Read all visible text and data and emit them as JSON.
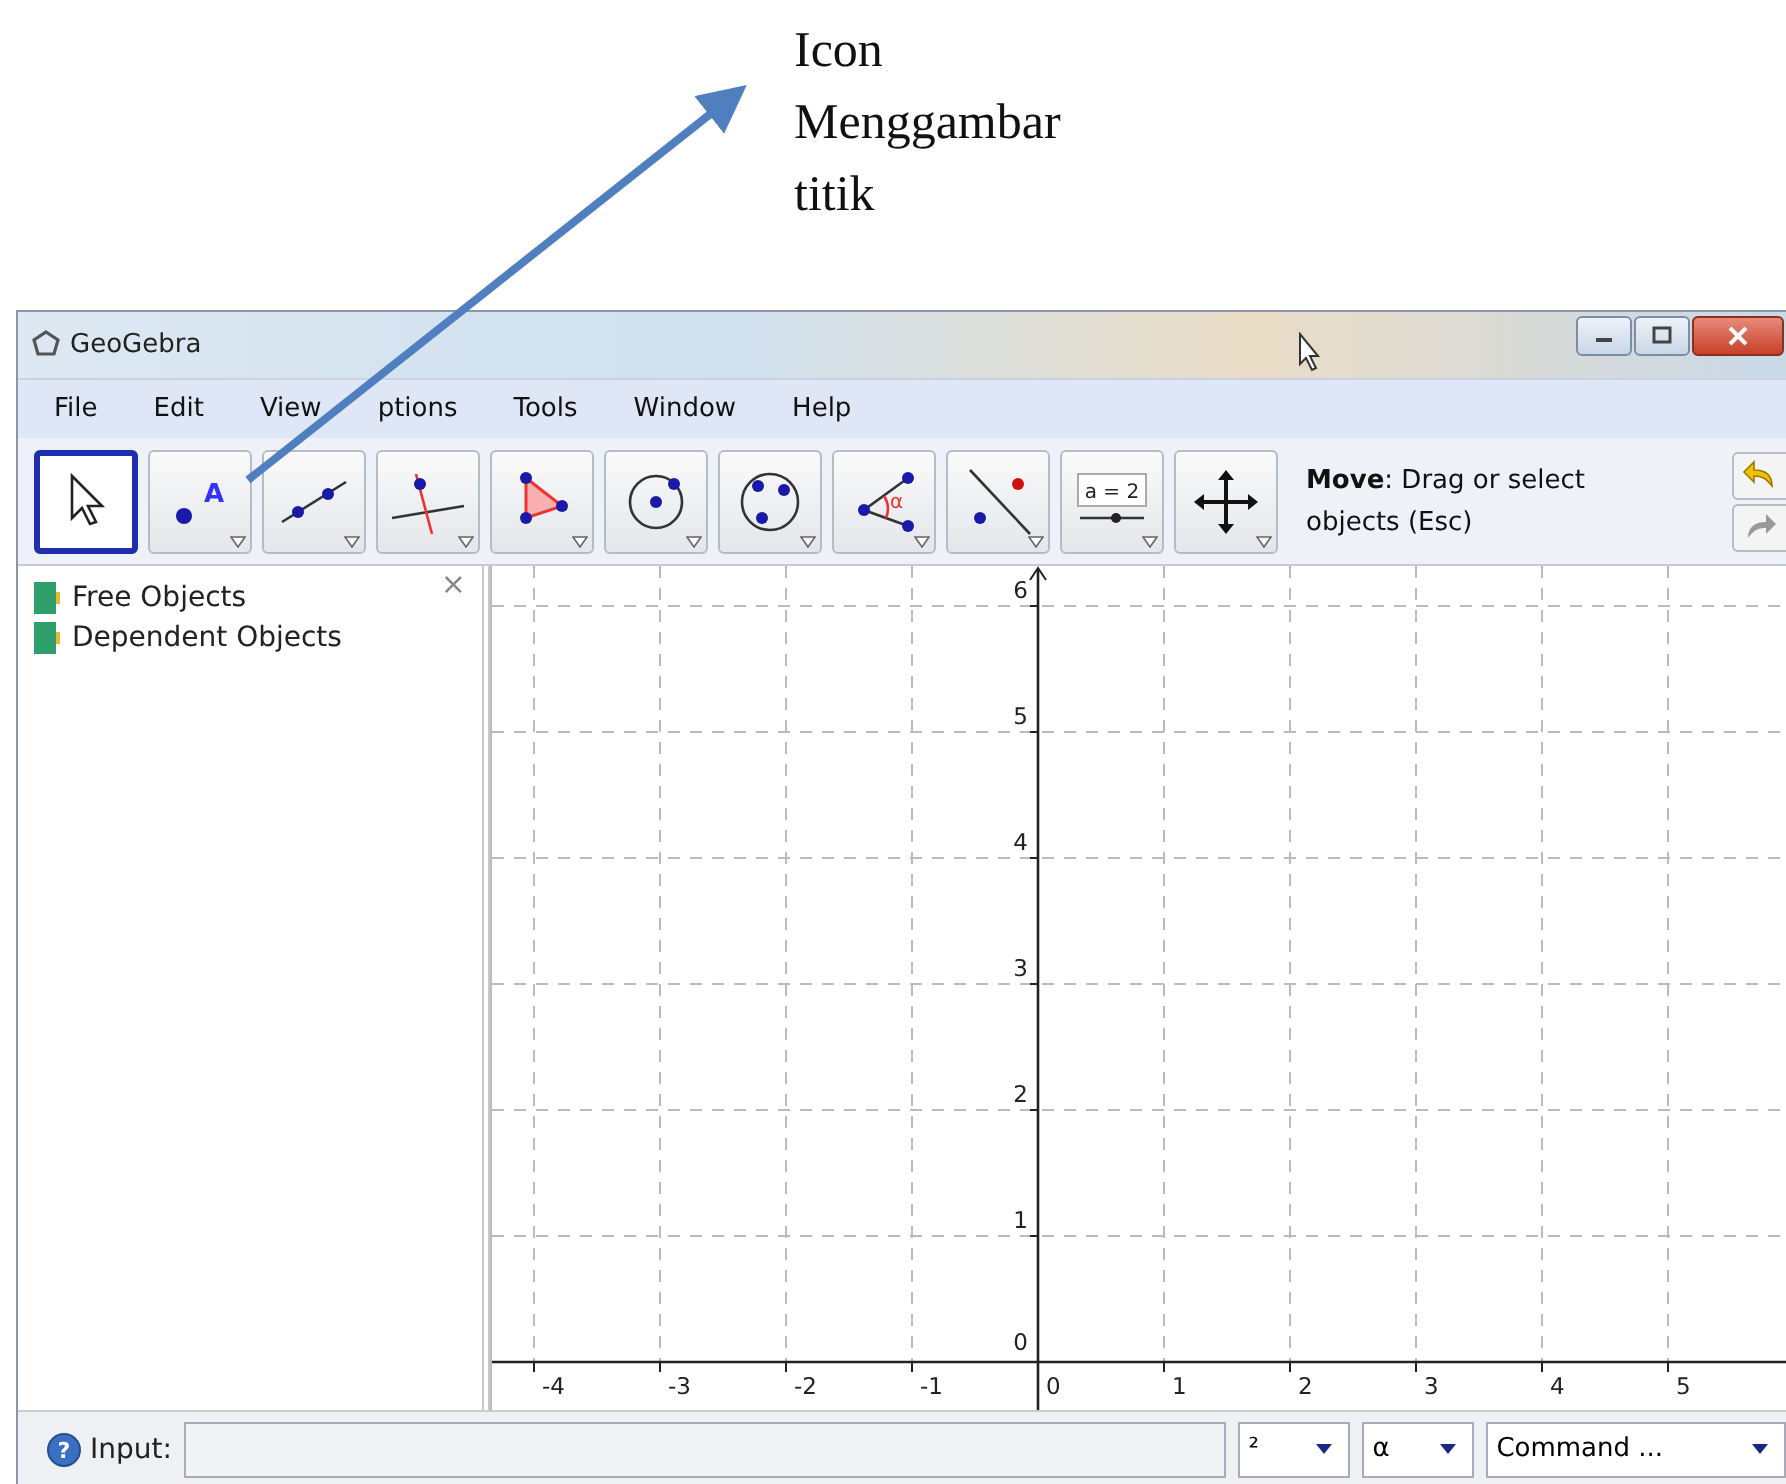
{
  "annotation": {
    "text": "Icon Menggambar titik"
  },
  "window": {
    "title": "GeoGebra"
  },
  "menu": [
    "File",
    "Edit",
    "View",
    "ptions",
    "Tools",
    "Window",
    "Help"
  ],
  "toolbar": {
    "tools": [
      {
        "kind": "move",
        "selected": true
      },
      {
        "kind": "point",
        "selected": false,
        "glyph": "A"
      },
      {
        "kind": "line",
        "selected": false
      },
      {
        "kind": "perpendicular",
        "selected": false
      },
      {
        "kind": "polygon",
        "selected": false
      },
      {
        "kind": "circle",
        "selected": false
      },
      {
        "kind": "conic",
        "selected": false
      },
      {
        "kind": "angle",
        "selected": false,
        "glyph": "α"
      },
      {
        "kind": "reflect",
        "selected": false
      },
      {
        "kind": "slider",
        "selected": false,
        "glyph": "a = 2"
      },
      {
        "kind": "move_view",
        "selected": false
      }
    ],
    "help": "**Move**: Drag or select objects (Esc)"
  },
  "algebra": {
    "items": [
      "Free Objects",
      "Dependent Objects"
    ],
    "close": "×"
  },
  "graphics": {
    "x_labels": [
      "-4",
      "-3",
      "-2",
      "-1",
      "0",
      "1",
      "2",
      "3",
      "4",
      "5"
    ],
    "y_labels": [
      "6",
      "5",
      "4",
      "3",
      "2",
      "1",
      "0"
    ]
  },
  "input_bar": {
    "help": "?",
    "label": "Input:",
    "dropdowns": [
      "²",
      "α",
      "Command ..."
    ]
  }
}
